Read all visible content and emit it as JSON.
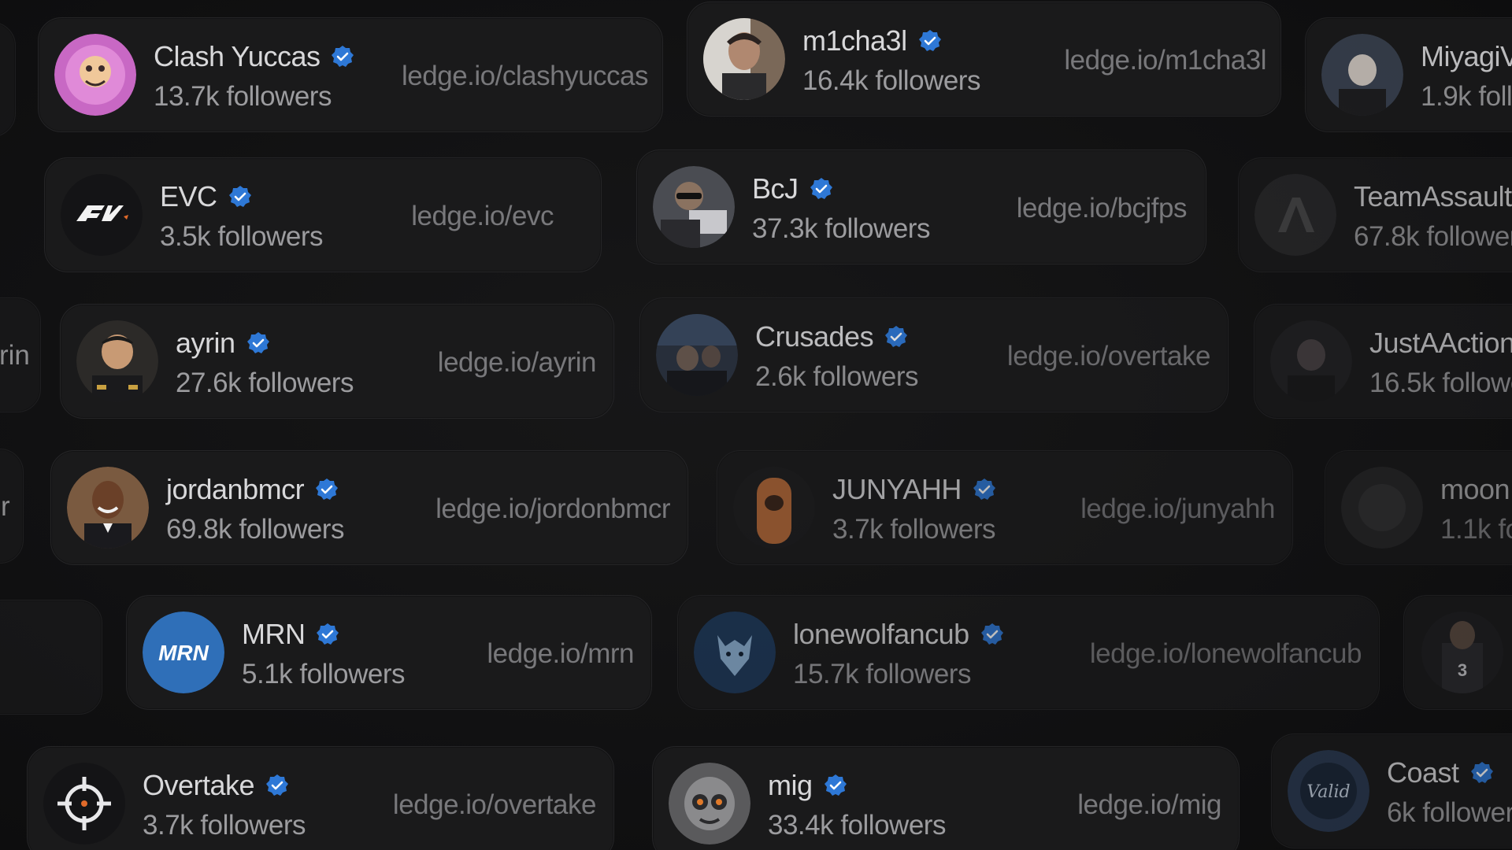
{
  "cards": [
    {
      "id": "clashyuccas",
      "name": "Clash Yuccas",
      "followers": "13.7k followers",
      "link": "ledge.io/clashyuccas",
      "avatar_color": "#c868c4"
    },
    {
      "id": "m1cha3l",
      "name": "m1cha3l",
      "followers": "16.4k followers",
      "link": "ledge.io/m1cha3l",
      "avatar_color": "#6b5a4e"
    },
    {
      "id": "miyagi",
      "name": "MiyagiV",
      "followers": "1.9k follo",
      "link": "",
      "avatar_color": "#3a4250"
    },
    {
      "id": "evc",
      "name": "EVC",
      "followers": "3.5k followers",
      "link": "ledge.io/evc",
      "avatar_color": "#141416"
    },
    {
      "id": "bcj",
      "name": "BcJ",
      "followers": "37.3k followers",
      "link": "ledge.io/bcjfps",
      "avatar_color": "#4a4c52"
    },
    {
      "id": "teamassault",
      "name": "TeamAssault",
      "followers": "67.8k follower",
      "link": "",
      "avatar_color": "#2a2a2c"
    },
    {
      "id": "ayrin",
      "name": "ayrin",
      "followers": "27.6k followers",
      "link": "ledge.io/ayrin",
      "avatar_color": "#2c2a28"
    },
    {
      "id": "crusades",
      "name": "Crusades",
      "followers": "2.6k followers",
      "link": "ledge.io/overtake",
      "avatar_color": "#2a3240"
    },
    {
      "id": "justaaction",
      "name": "JustAAction",
      "followers": "16.5k followe",
      "link": "",
      "avatar_color": "#222224"
    },
    {
      "id": "jordanbmcr",
      "name": "jordanbmcr",
      "followers": "69.8k followers",
      "link": "ledge.io/jordonbmcr",
      "avatar_color": "#7a5a40"
    },
    {
      "id": "junyahh",
      "name": "JUNYAHH",
      "followers": "3.7k followers",
      "link": "ledge.io/junyahh",
      "avatar_color": "#8a5030"
    },
    {
      "id": "moon",
      "name": "moon",
      "followers": "1.1k fol",
      "link": "",
      "avatar_color": "#2c2c2e"
    },
    {
      "id": "mrn",
      "name": "MRN",
      "followers": "5.1k followers",
      "link": "ledge.io/mrn",
      "avatar_color": "#2f6fb8"
    },
    {
      "id": "lonewolfancub",
      "name": "lonewolfancub",
      "followers": "15.7k followers",
      "link": "ledge.io/lonewolfancub",
      "avatar_color": "#1e3a5c"
    },
    {
      "id": "overtake",
      "name": "Overtake",
      "followers": "3.7k followers",
      "link": "ledge.io/overtake",
      "avatar_color": "#141416"
    },
    {
      "id": "mig",
      "name": "mig",
      "followers": "33.4k followers",
      "link": "ledge.io/mig",
      "avatar_color": "#5a5a5c"
    },
    {
      "id": "coast",
      "name": "Coast",
      "followers": "6k follower",
      "link": "",
      "avatar_color": "#2a3a52"
    }
  ],
  "edge_fragments": {
    "row3_left": "rin",
    "row4_left": "r"
  },
  "colors": {
    "verified": "#2e78d6",
    "card_bg": "#1a1a1b",
    "name_text": "#d8d8da",
    "followers_text": "#9c9c9f",
    "link_text": "#78787b"
  }
}
